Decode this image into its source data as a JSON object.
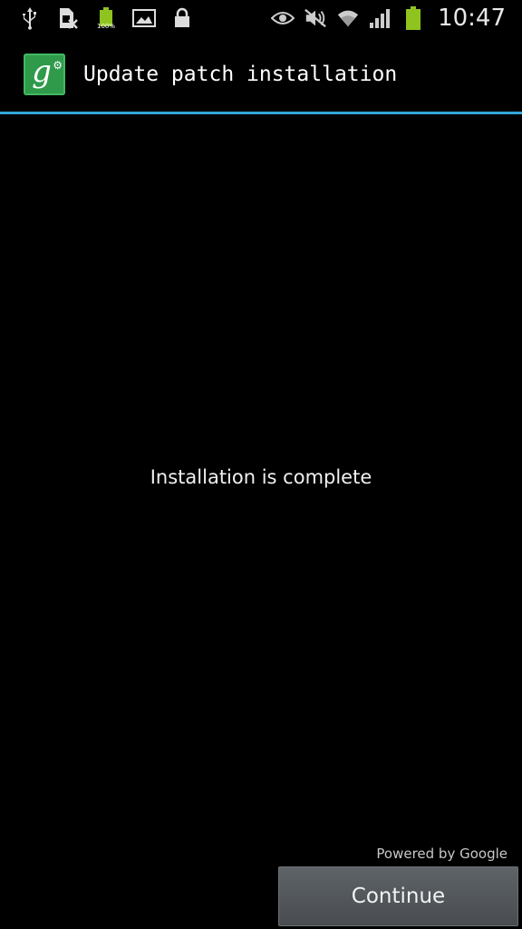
{
  "status_bar": {
    "time": "10:47",
    "battery_small_label": "100%",
    "left_icons": [
      "usb-icon",
      "sim-card-error-icon",
      "battery-full-icon",
      "image-icon",
      "lock-icon"
    ],
    "right_icons": [
      "eye-icon",
      "mute-icon",
      "wifi-icon",
      "signal-icon",
      "battery-icon"
    ],
    "battery_color": "#8fc31f"
  },
  "action_bar": {
    "title": "Update patch installation",
    "icon": "google-settings-icon",
    "accent_color": "#33a6d9"
  },
  "main": {
    "message": "Installation is complete"
  },
  "footer": {
    "powered_by": "Powered by Google",
    "continue_label": "Continue"
  }
}
